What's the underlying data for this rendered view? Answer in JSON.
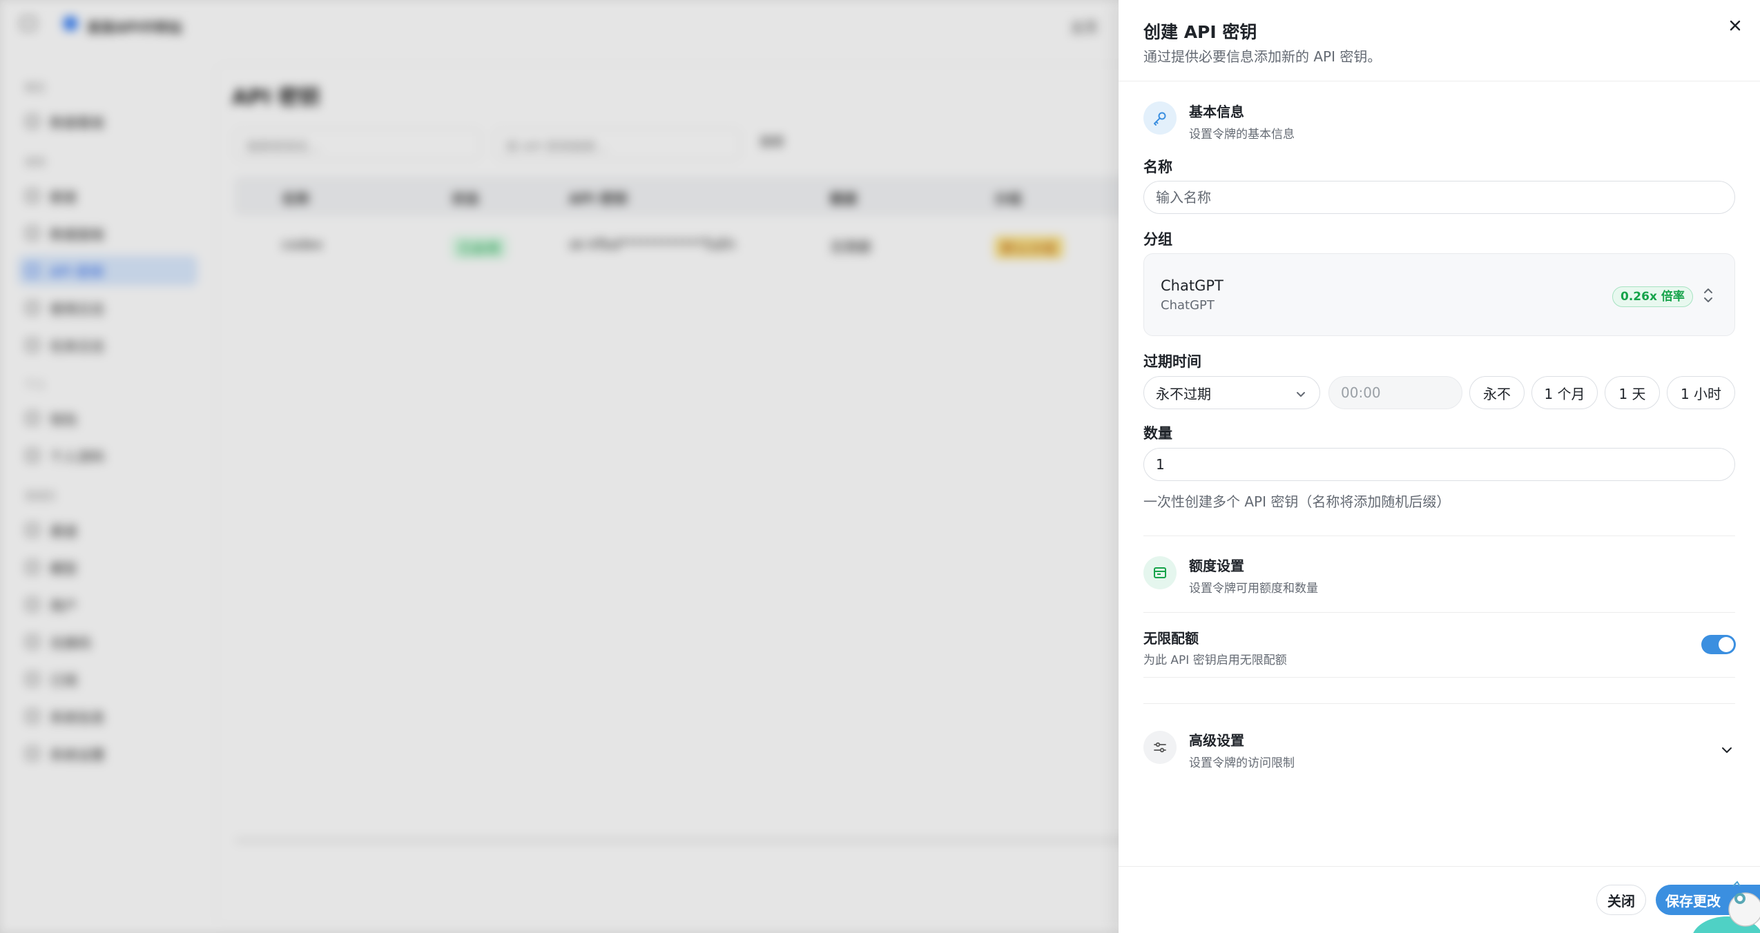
{
  "background": {
    "app_title": "某某API中转站",
    "top_right": "主页",
    "sidebar": {
      "groups": [
        "概览",
        "使用",
        "个人",
        "管理员"
      ],
      "items": [
        "数据看板",
        "额度",
        "数据面板",
        "API 密钥",
        "使用日志",
        "任务日志",
        "钱包",
        "个人资料",
        "渠道",
        "模型",
        "用户",
        "兑换码",
        "订阅",
        "系统信息",
        "系统设置"
      ]
    },
    "page_title": "API 密钥",
    "filters": {
      "name_placeholder": "搜索密钥名...",
      "key_placeholder": "按 API 密钥搜索...",
      "search_button": "搜索"
    },
    "table": {
      "headers": [
        "名称",
        "状态",
        "API 密钥",
        "额度",
        "分组"
      ],
      "rows": [
        {
          "name": "codex",
          "status": "已启用",
          "key": "sk-Vfbd************TuEh",
          "quota": "无限额",
          "group": "默认分组"
        }
      ]
    }
  },
  "drawer": {
    "title": "创建 API 密钥",
    "subtitle": "通过提供必要信息添加新的 API 密钥。",
    "basic": {
      "title": "基本信息",
      "desc": "设置令牌的基本信息"
    },
    "name_field": {
      "label": "名称",
      "placeholder": "输入名称",
      "value": ""
    },
    "group_field": {
      "label": "分组",
      "name": "ChatGPT",
      "sub": "ChatGPT",
      "ratio": "0.26x 倍率"
    },
    "expire_field": {
      "label": "过期时间",
      "selected": "永不过期",
      "time_placeholder": "00:00",
      "quick_options": [
        "永不",
        "1 个月",
        "1 天",
        "1 小时"
      ]
    },
    "count_field": {
      "label": "数量",
      "value": "1",
      "help": "一次性创建多个 API 密钥（名称将添加随机后缀）"
    },
    "quota": {
      "title": "额度设置",
      "desc": "设置令牌可用额度和数量"
    },
    "unlimited": {
      "title": "无限配额",
      "desc": "为此 API 密钥启用无限配额",
      "enabled": true
    },
    "advanced": {
      "title": "高级设置",
      "desc": "设置令牌的访问限制"
    },
    "footer": {
      "close_label": "关闭",
      "save_label": "保存更改"
    }
  },
  "colors": {
    "accent": "#3b8fe0",
    "ratio_green": "#16a34a",
    "muted_text": "#646a73"
  },
  "icons": [
    "close-icon",
    "key-icon",
    "chevrons-up-down-icon",
    "chevron-down-icon",
    "wallet-icon",
    "sliders-icon"
  ]
}
